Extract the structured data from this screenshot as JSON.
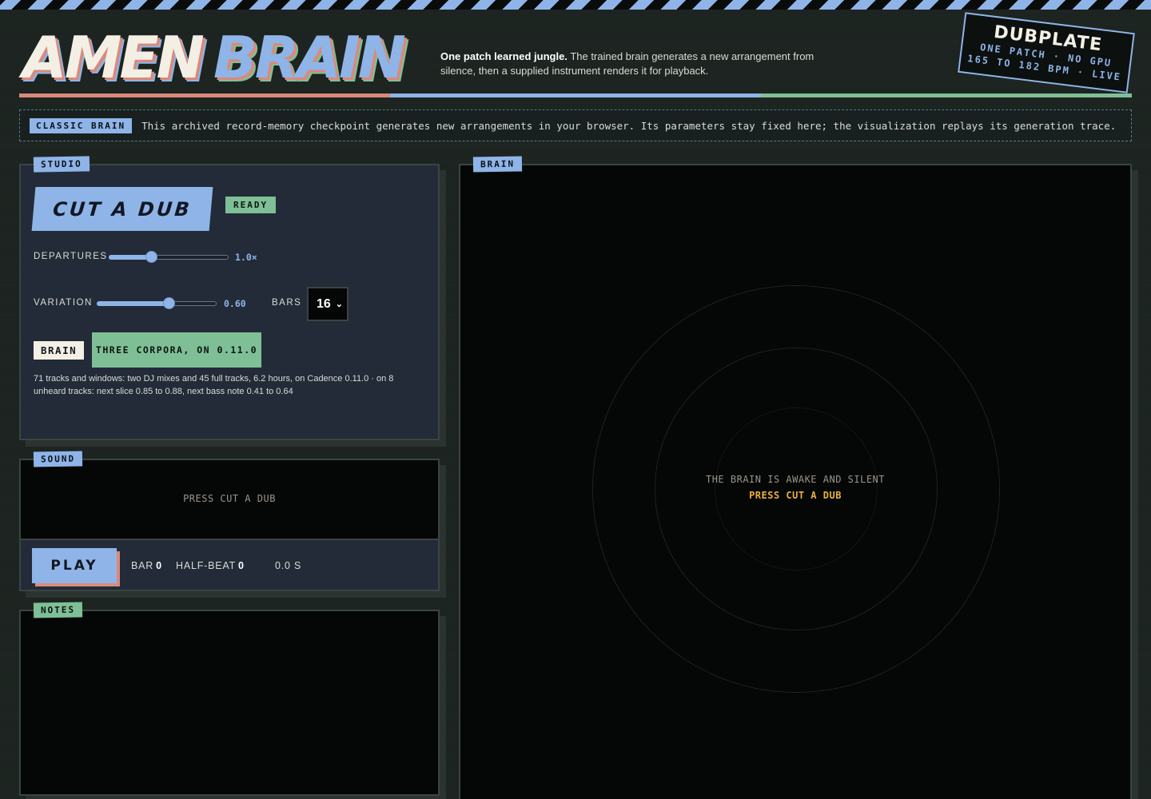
{
  "header": {
    "title_word1": "AMEN",
    "title_word2": "BRAIN",
    "tagline_bold": "One patch learned jungle.",
    "tagline_rest": "The trained brain generates a new arrangement from silence, then a supplied instrument renders it for playback."
  },
  "stamp": {
    "title": "DUBPLATE",
    "line1": "ONE PATCH · NO GPU",
    "line2": "165 TO 182 BPM · LIVE"
  },
  "banner": {
    "chip": "CLASSIC BRAIN",
    "text": "This archived record-memory checkpoint generates new arrangements in your browser. Its parameters stay fixed here; the visualization replays its generation trace."
  },
  "studio": {
    "tab": "STUDIO",
    "cut_button": "CUT A DUB",
    "status": "READY",
    "departures_label": "DEPARTURES",
    "departures_value": "1.0×",
    "departures_level": 0.35,
    "variation_label": "VARIATION",
    "variation_value": "0.60",
    "variation_level": 0.6,
    "bars_label": "BARS",
    "bars_value": "16",
    "brain_label": "BRAIN",
    "brain_button": "THREE CORPORA, ON 0.11.0",
    "brain_description": "71 tracks and windows: two DJ mixes and 45 full tracks, 6.2 hours, on Cadence 0.11.0 · on 8 unheard tracks: next slice 0.85 to 0.88, next bass note 0.41 to 0.64"
  },
  "sound": {
    "tab": "SOUND",
    "message": "PRESS CUT A DUB",
    "play_button": "PLAY",
    "bar_label": "BAR",
    "bar_value": "0",
    "halfbeat_label": "HALF-BEAT",
    "halfbeat_value": "0",
    "time": "0.0 S"
  },
  "notes": {
    "tab": "NOTES"
  },
  "brain": {
    "tab": "BRAIN",
    "idle_line1": "THE BRAIN IS AWAKE AND SILENT",
    "idle_line2": "PRESS CUT A DUB"
  },
  "colors": {
    "accent_blue": "#8fb4e8",
    "accent_green": "#7fbf95",
    "accent_salmon": "#d98a7c",
    "accent_amber": "#e8b23a"
  }
}
